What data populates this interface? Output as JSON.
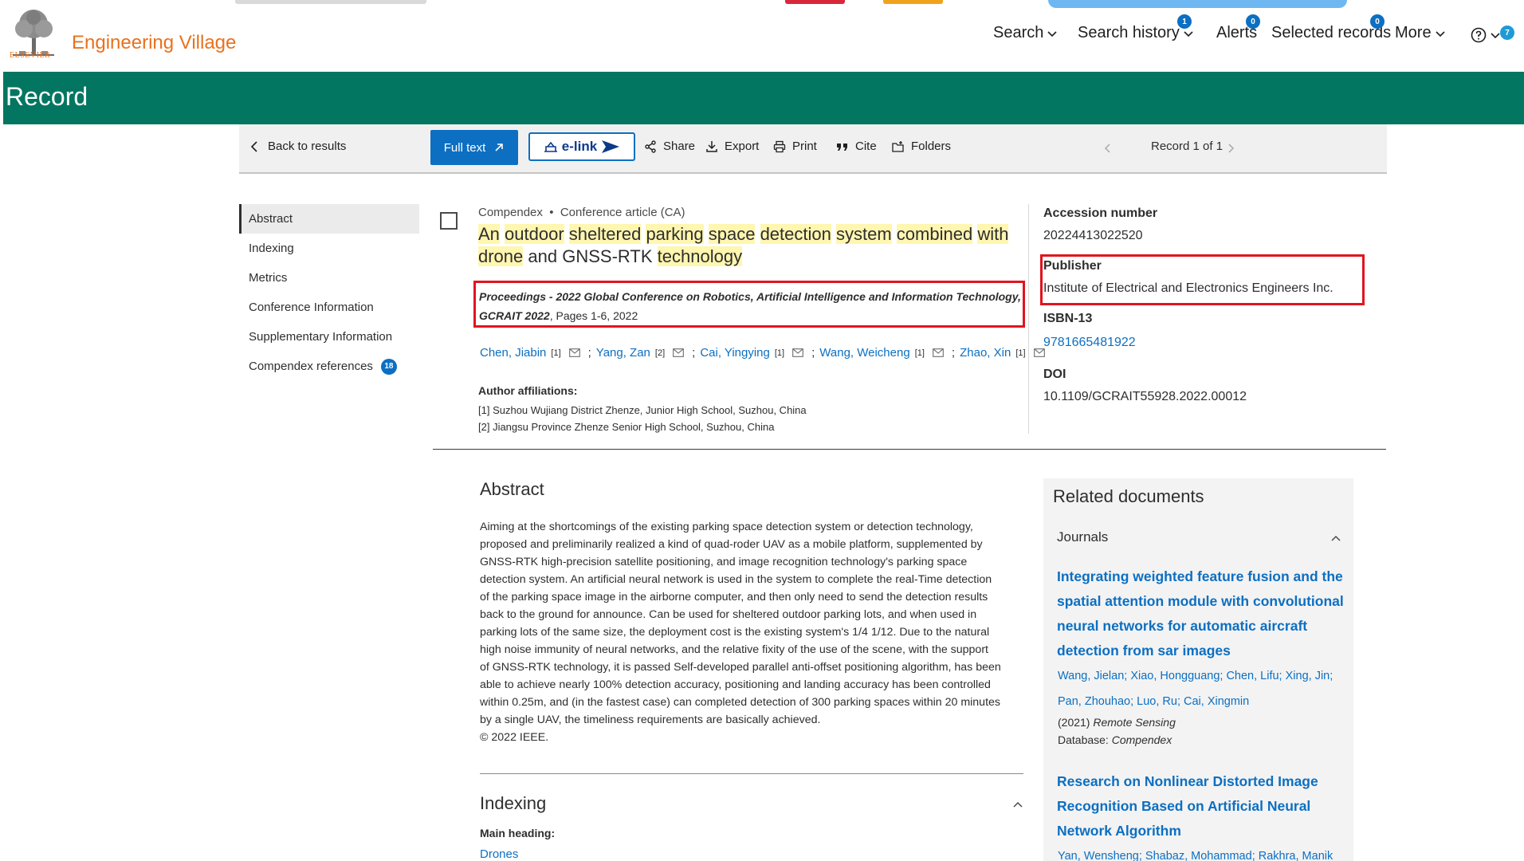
{
  "header": {
    "logo_word": "ELSEVIER",
    "brand": "Engineering Village",
    "nav": {
      "search": "Search",
      "search_history": "Search history",
      "search_history_count": "1",
      "alerts": "Alerts",
      "alerts_count": "0",
      "selected_records": "Selected records",
      "selected_records_count": "0",
      "more": "More",
      "help_count": "7"
    }
  },
  "banner": {
    "title": "Record"
  },
  "toolbar": {
    "back": "Back to results",
    "full_text": "Full text",
    "elink": "e-link",
    "share": "Share",
    "export": "Export",
    "print": "Print",
    "cite": "Cite",
    "folders": "Folders",
    "record_position": "Record 1 of 1"
  },
  "sidebar": {
    "items": [
      {
        "label": "Abstract"
      },
      {
        "label": "Indexing"
      },
      {
        "label": "Metrics"
      },
      {
        "label": "Conference Information"
      },
      {
        "label": "Supplementary Information"
      },
      {
        "label": "Compendex references",
        "badge": "18"
      }
    ]
  },
  "record": {
    "database": "Compendex",
    "doc_type": "Conference article (CA)",
    "title_words": [
      "An",
      "outdoor",
      "sheltered",
      "parking",
      "space",
      "detection",
      "system",
      "combined",
      "with",
      "drone",
      "and",
      "GNSS-RTK",
      "technology"
    ],
    "source_italic": "Proceedings - 2022 Global Conference on Robotics, Artificial Intelligence and Information Technology, GCRAIT 2022",
    "source_rest": ", Pages 1-6, 2022",
    "authors": [
      {
        "name": "Chen, Jiabin",
        "aff": "[1]"
      },
      {
        "name": "Yang, Zan",
        "aff": "[2]"
      },
      {
        "name": "Cai, Yingying",
        "aff": "[1]"
      },
      {
        "name": "Wang, Weicheng",
        "aff": "[1]"
      },
      {
        "name": "Zhao, Xin",
        "aff": "[1]"
      }
    ],
    "affiliations_title": "Author affiliations:",
    "affiliations": [
      "[1] Suzhou Wujiang District Zhenze, Junior High School, Suzhou, China",
      "[2] Jiangsu Province Zhenze Senior High School, Suzhou, China"
    ]
  },
  "meta": {
    "accession_label": "Accession number",
    "accession_value": "20224413022520",
    "publisher_label": "Publisher",
    "publisher_value": "Institute of Electrical and Electronics Engineers Inc.",
    "isbn_label": "ISBN-13",
    "isbn_value": "9781665481922",
    "doi_label": "DOI",
    "doi_value": "10.1109/GCRAIT55928.2022.00012"
  },
  "abstract": {
    "heading": "Abstract",
    "lines": [
      "Aiming at the shortcomings of the existing parking space detection system or detection technology,",
      "proposed and preliminarily realized a kind of quad-roder UAV as a mobile platform, supplemented by",
      "GNSS-RTK high-precision satellite positioning, and image recognition technology's parking space",
      "detection system. An artificial neural network is used in the system to complete the real-Time detection",
      "of the parking space image in the airborne computer, and then only need to send the detection results",
      "back to the ground for announce. Can be used for sheltered outdoor parking lots, and when used in",
      "parking lots of the same size, the deployment cost is the existing system's 1/4 1/12. Due to the natural",
      "high noise immunity of neural networks, and the relative fixity of the use of the scene, with the support",
      "of GNSS-RTK technology, it is passed Self-developed parallel anti-offset positioning algorithm, has been",
      "able to achieve nearly 100% detection accuracy, positioning and landing accuracy has been controlled",
      "within 0.25m, and (in the fastest case) can completed detection of 300 parking spaces within 20 minutes",
      "by a single UAV, the timeliness requirements are basically achieved.",
      "© 2022 IEEE."
    ]
  },
  "indexing": {
    "heading": "Indexing",
    "main_heading_label": "Main heading:",
    "main_heading_value": "Drones"
  },
  "related": {
    "heading": "Related documents",
    "journals_label": "Journals",
    "doc1": {
      "title_lines": [
        "Integrating weighted feature fusion and the",
        "spatial attention module with convolutional",
        "neural networks for automatic aircraft",
        "detection from sar images"
      ],
      "author_lines": [
        "Wang, Jielan; Xiao, Hongguang; Chen, Lifu; Xing, Jin;",
        "Pan, Zhouhao;  Luo, Ru;  Cai, Xingmin"
      ],
      "year": "(2021)",
      "journal": "Remote Sensing",
      "db_label": "Database:",
      "db_value": "Compendex"
    },
    "doc2": {
      "title_lines": [
        "Research on Nonlinear Distorted Image",
        "Recognition Based on Artificial Neural",
        "Network Algorithm"
      ],
      "author_line": "Yan, Wensheng; Shabaz, Mohammad; Rakhra, Manik"
    }
  }
}
